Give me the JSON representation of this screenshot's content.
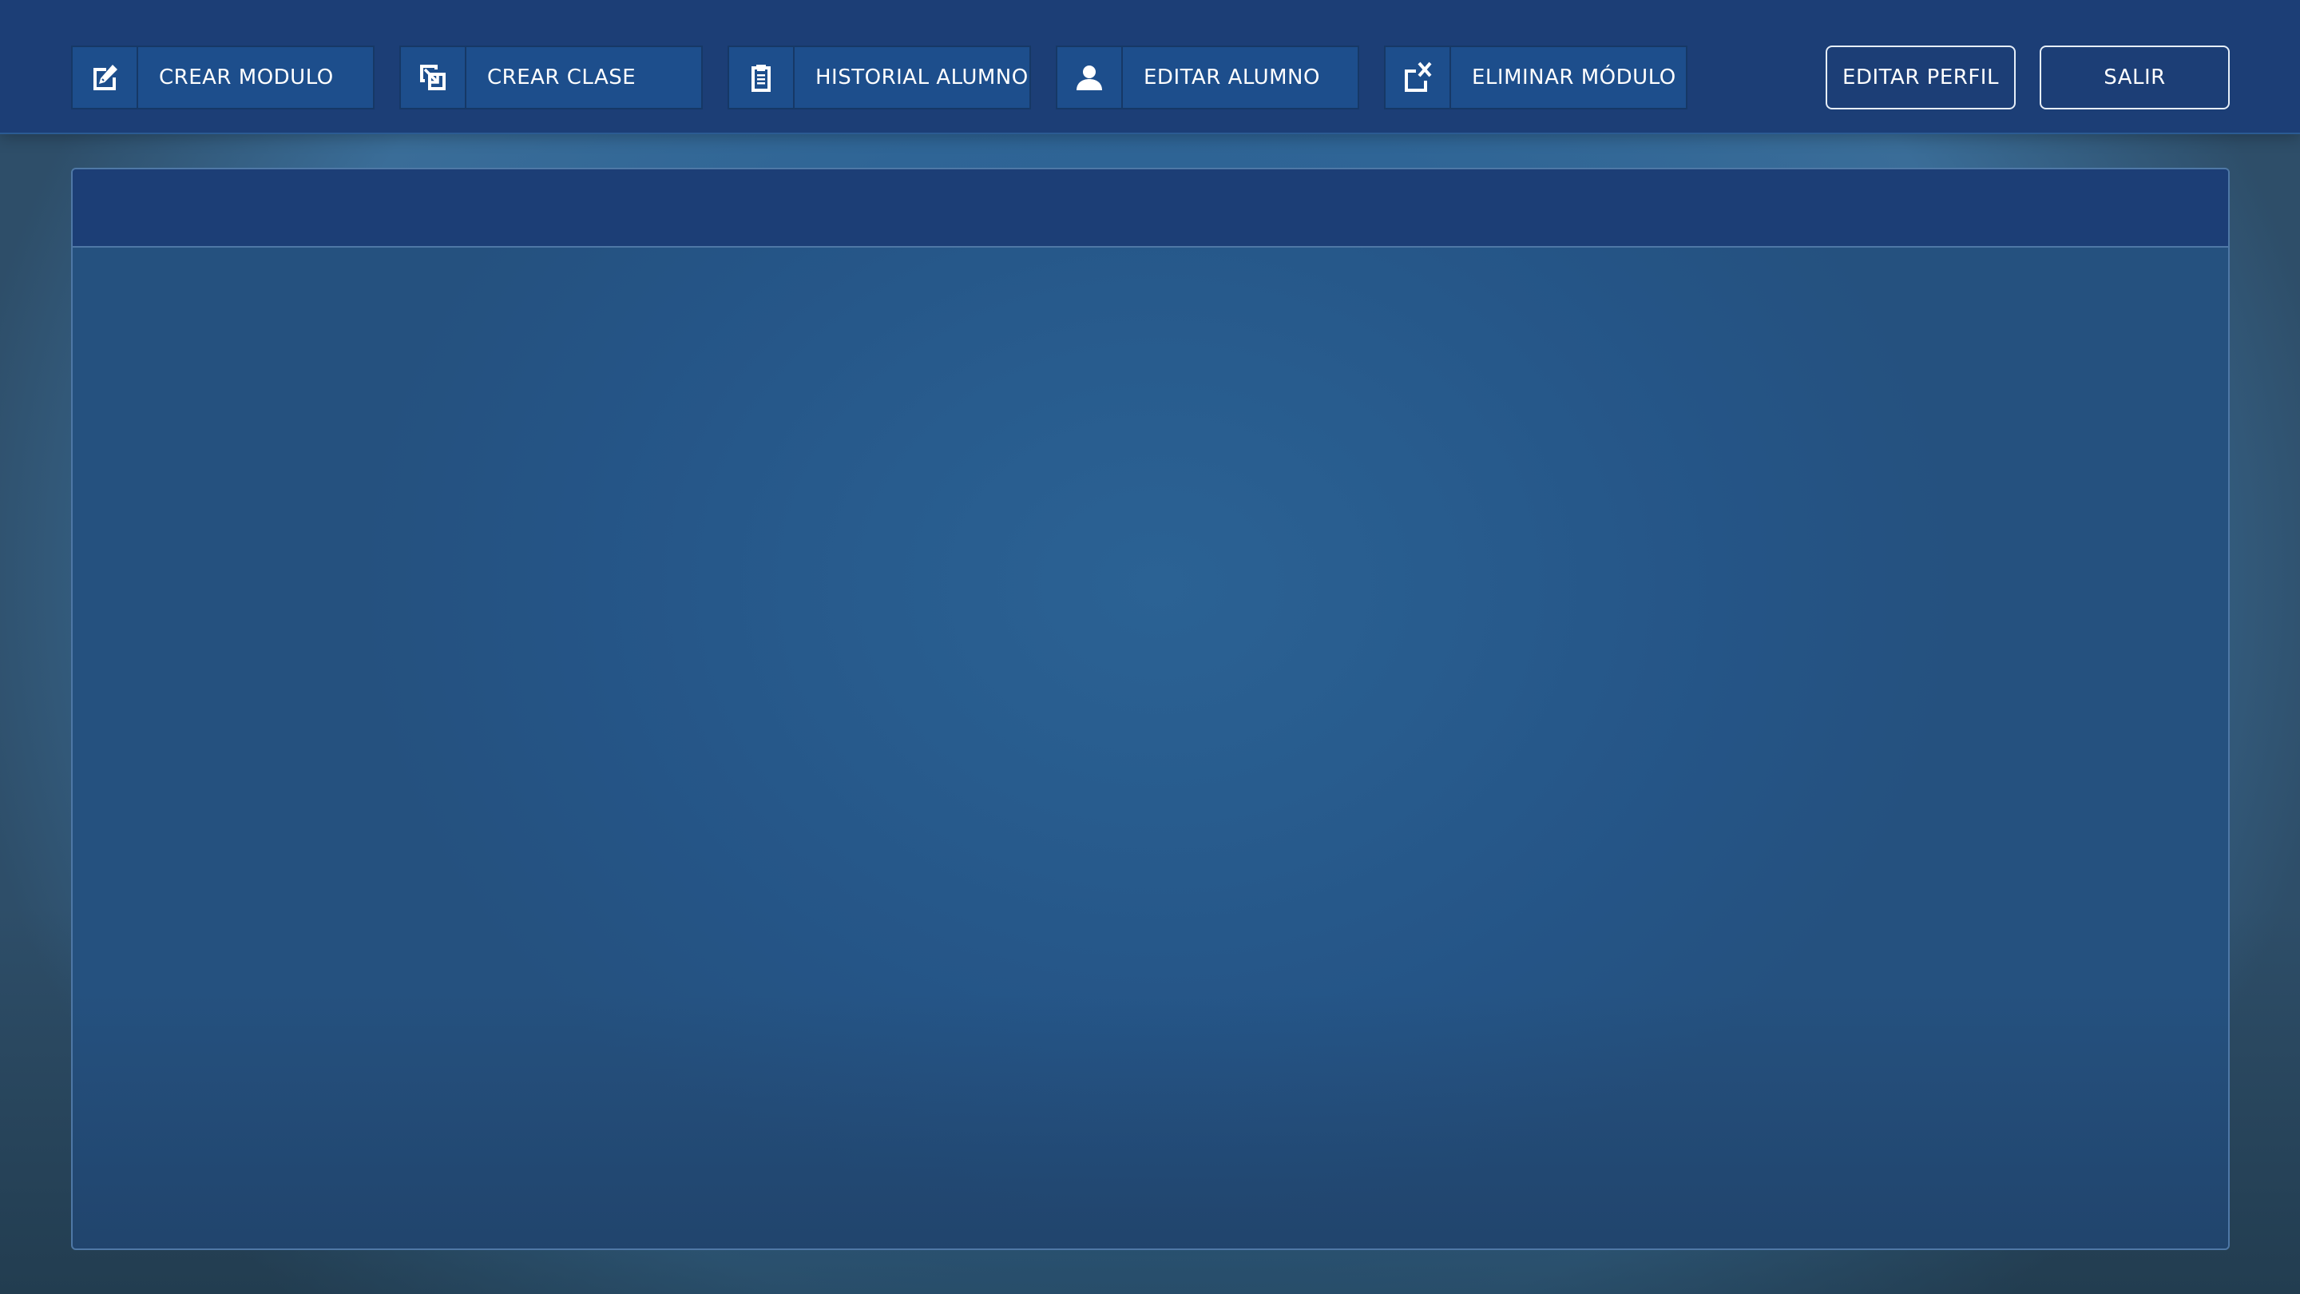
{
  "toolbar": {
    "buttons": [
      {
        "label": "CREAR MODULO",
        "icon": "edit-icon"
      },
      {
        "label": "CREAR CLASE",
        "icon": "create-class-icon"
      },
      {
        "label": "HISTORIAL ALUMNO",
        "icon": "clipboard-icon"
      },
      {
        "label": "EDITAR ALUMNO",
        "icon": "user-icon"
      },
      {
        "label": "ELIMINAR MÓDULO",
        "icon": "delete-module-icon"
      }
    ],
    "edit_profile_label": "EDITAR PERFIL",
    "logout_label": "SALIR"
  },
  "panel": {
    "title": ""
  },
  "colors": {
    "topbar": "#1c3e76",
    "button_bg": "#1d4e8c",
    "button_border": "#163866",
    "panel_header": "#1c3e76",
    "panel_bg": "#285c8e",
    "text": "#ffffff"
  }
}
